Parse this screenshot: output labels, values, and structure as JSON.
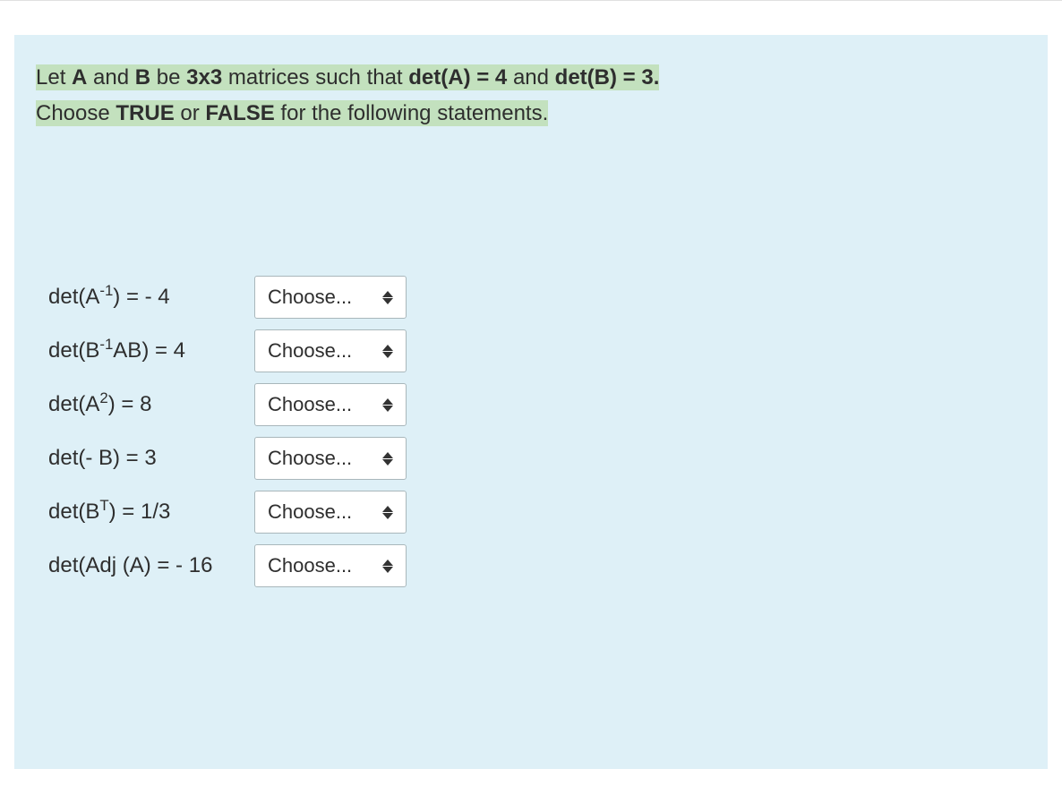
{
  "intro": {
    "line1_pre": "Let ",
    "A": "A",
    "and": " and ",
    "B": "B",
    "be": " be ",
    "size": "3x3",
    "matrices": " matrices such that ",
    "detA": "det(A) = 4",
    "and2": " and ",
    "detB": "det(B) = 3.",
    "line2_pre": "Choose ",
    "true": "TRUE",
    "or": " or ",
    "false": "FALSE",
    "line2_post": " for the following statements."
  },
  "select_placeholder": "Choose...",
  "items": [
    {
      "label_pre": "det(A",
      "sup": "-1",
      "label_post": ") = - 4"
    },
    {
      "label_pre": "det(B",
      "sup": "-1",
      "label_post": "AB) = 4"
    },
    {
      "label_pre": "det(A",
      "sup": "2",
      "label_post": ") = 8"
    },
    {
      "label_pre": "det(- B) = 3",
      "sup": "",
      "label_post": ""
    },
    {
      "label_pre": "det(B",
      "sup": "T",
      "label_post": ") = 1/3"
    },
    {
      "label_pre": "det(Adj (A) = - 16",
      "sup": "",
      "label_post": ""
    }
  ]
}
